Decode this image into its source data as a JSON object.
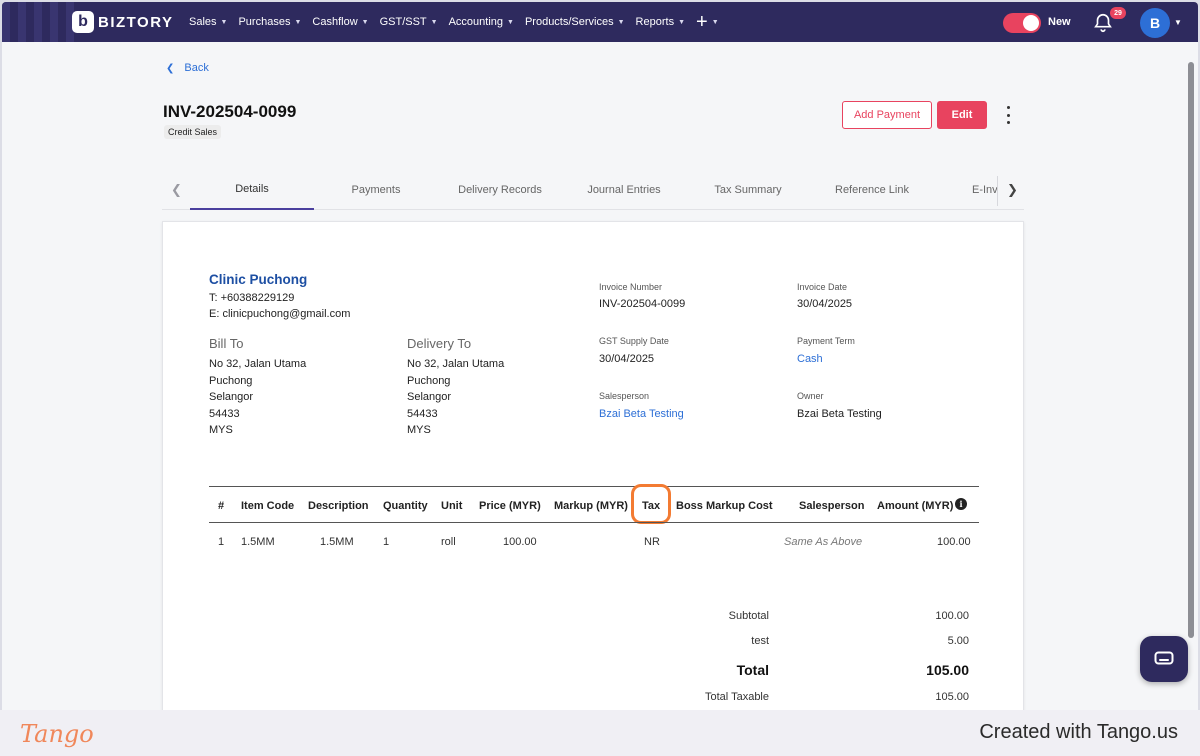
{
  "topbar": {
    "brand": "BIZTORY",
    "brand_mark": "b",
    "nav": [
      "Sales",
      "Purchases",
      "Cashflow",
      "GST/SST",
      "Accounting",
      "Products/Services",
      "Reports"
    ],
    "plus_label": "+",
    "toggle_label": "New",
    "notification_count": "29",
    "avatar_initial": "B"
  },
  "page": {
    "back_label": "Back",
    "invoice_title": "INV-202504-0099",
    "invoice_type": "Credit Sales",
    "add_payment_label": "Add Payment",
    "edit_label": "Edit"
  },
  "tabs": [
    "Details",
    "Payments",
    "Delivery Records",
    "Journal Entries",
    "Tax Summary",
    "Reference Link",
    "E-Invoice"
  ],
  "invoice": {
    "company": "Clinic Puchong",
    "phone": "T: +60388229129",
    "email": "E: clinicpuchong@gmail.com",
    "bill_to_heading": "Bill To",
    "bill_to": [
      "No 32, Jalan Utama",
      "Puchong",
      "Selangor",
      "54433",
      "MYS"
    ],
    "delivery_to_heading": "Delivery To",
    "delivery_to": [
      "No 32, Jalan Utama",
      "Puchong",
      "Selangor",
      "54433",
      "MYS"
    ],
    "invoice_number_label": "Invoice Number",
    "invoice_number": "INV-202504-0099",
    "invoice_date_label": "Invoice Date",
    "invoice_date": "30/04/2025",
    "gst_supply_date_label": "GST Supply Date",
    "gst_supply_date": "30/04/2025",
    "payment_term_label": "Payment Term",
    "payment_term": "Cash",
    "salesperson_label": "Salesperson",
    "salesperson": "Bzai Beta Testing",
    "owner_label": "Owner",
    "owner": "Bzai Beta Testing"
  },
  "table": {
    "headers": [
      "#",
      "Item Code",
      "Description",
      "Quantity",
      "Unit",
      "Price (MYR)",
      "Markup (MYR)",
      "Tax",
      "Boss Markup Cost",
      "Salesperson",
      "Amount (MYR)"
    ],
    "info_icon": "i",
    "rows": [
      {
        "no": "1",
        "item_code": "1.5MM",
        "description": "1.5MM",
        "quantity": "1",
        "unit": "roll",
        "price": "100.00",
        "markup": "",
        "tax": "NR",
        "boss_markup": "",
        "salesperson": "Same As Above",
        "amount": "100.00"
      }
    ]
  },
  "summary": {
    "subtotal_label": "Subtotal",
    "subtotal": "100.00",
    "test_label": "test",
    "test": "5.00",
    "total_label": "Total",
    "total": "105.00",
    "taxable_label": "Total Taxable",
    "taxable": "105.00"
  },
  "footer": {
    "logo": "Tango",
    "credit": "Created with Tango.us"
  },
  "colors": {
    "topbar": "#2e2a5e",
    "accent": "#e8435f",
    "link": "#2d6fd6",
    "highlight": "#f37b32"
  }
}
